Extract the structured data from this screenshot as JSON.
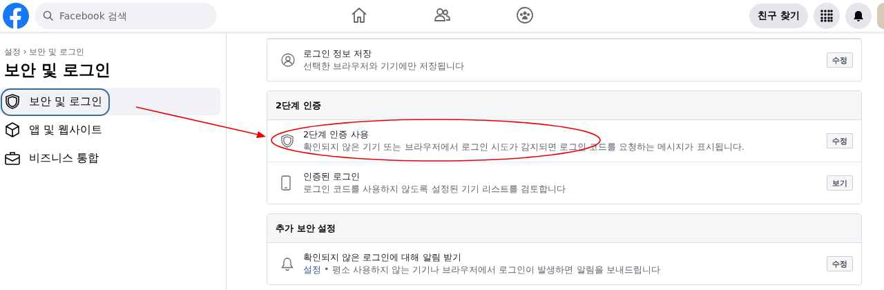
{
  "topbar": {
    "search": {
      "placeholder": "Facebook 검색"
    },
    "nav": [
      {
        "kind": "home",
        "selected": false
      },
      {
        "kind": "friends",
        "selected": false
      },
      {
        "kind": "groups",
        "selected": false
      }
    ],
    "find_friends": "친구 찾기"
  },
  "sidebar": {
    "breadcrumb": "설정 › 보안 및 로그인",
    "title": "보안 및 로그인",
    "items": [
      {
        "kind": "shield",
        "label": "보안 및 로그인",
        "selected": true
      },
      {
        "kind": "cube",
        "label": "앱 및 웹사이트",
        "selected": false
      },
      {
        "kind": "briefcase",
        "label": "비즈니스 통합",
        "selected": false
      }
    ]
  },
  "sections": [
    {
      "rows": [
        {
          "kind": "person",
          "title": "로그인 정보 저장",
          "description": "선택한 브라우저와 기기에만 저장됩니다",
          "button": "수정"
        }
      ]
    },
    {
      "header": "2단계 인증",
      "rows": [
        {
          "kind": "shield",
          "title": "2단계 인증 사용",
          "description": "확인되지 않은 기기 또는 브라우저에서 로그인 시도가 감지되면 로그인 코드를 요청하는 메시지가 표시됩니다.",
          "button": "수정",
          "circled": true
        },
        {
          "kind": "phone",
          "title": "인증된 로그인",
          "description": "로그인 코드를 사용하지 않도록 설정된 기기 리스트를 검토합니다",
          "button": "보기"
        }
      ]
    },
    {
      "header": "추가 보안 설정",
      "rows": [
        {
          "kind": "bell",
          "title": "확인되지 않은 로그인에 대해 알림 받기",
          "status_link": "설정",
          "separator": "•",
          "description": "평소 사용하지 않는 기기나 브라우저에서 로그인이 발생하면 알림을 보내드립니다",
          "button": "수정"
        }
      ]
    }
  ]
}
